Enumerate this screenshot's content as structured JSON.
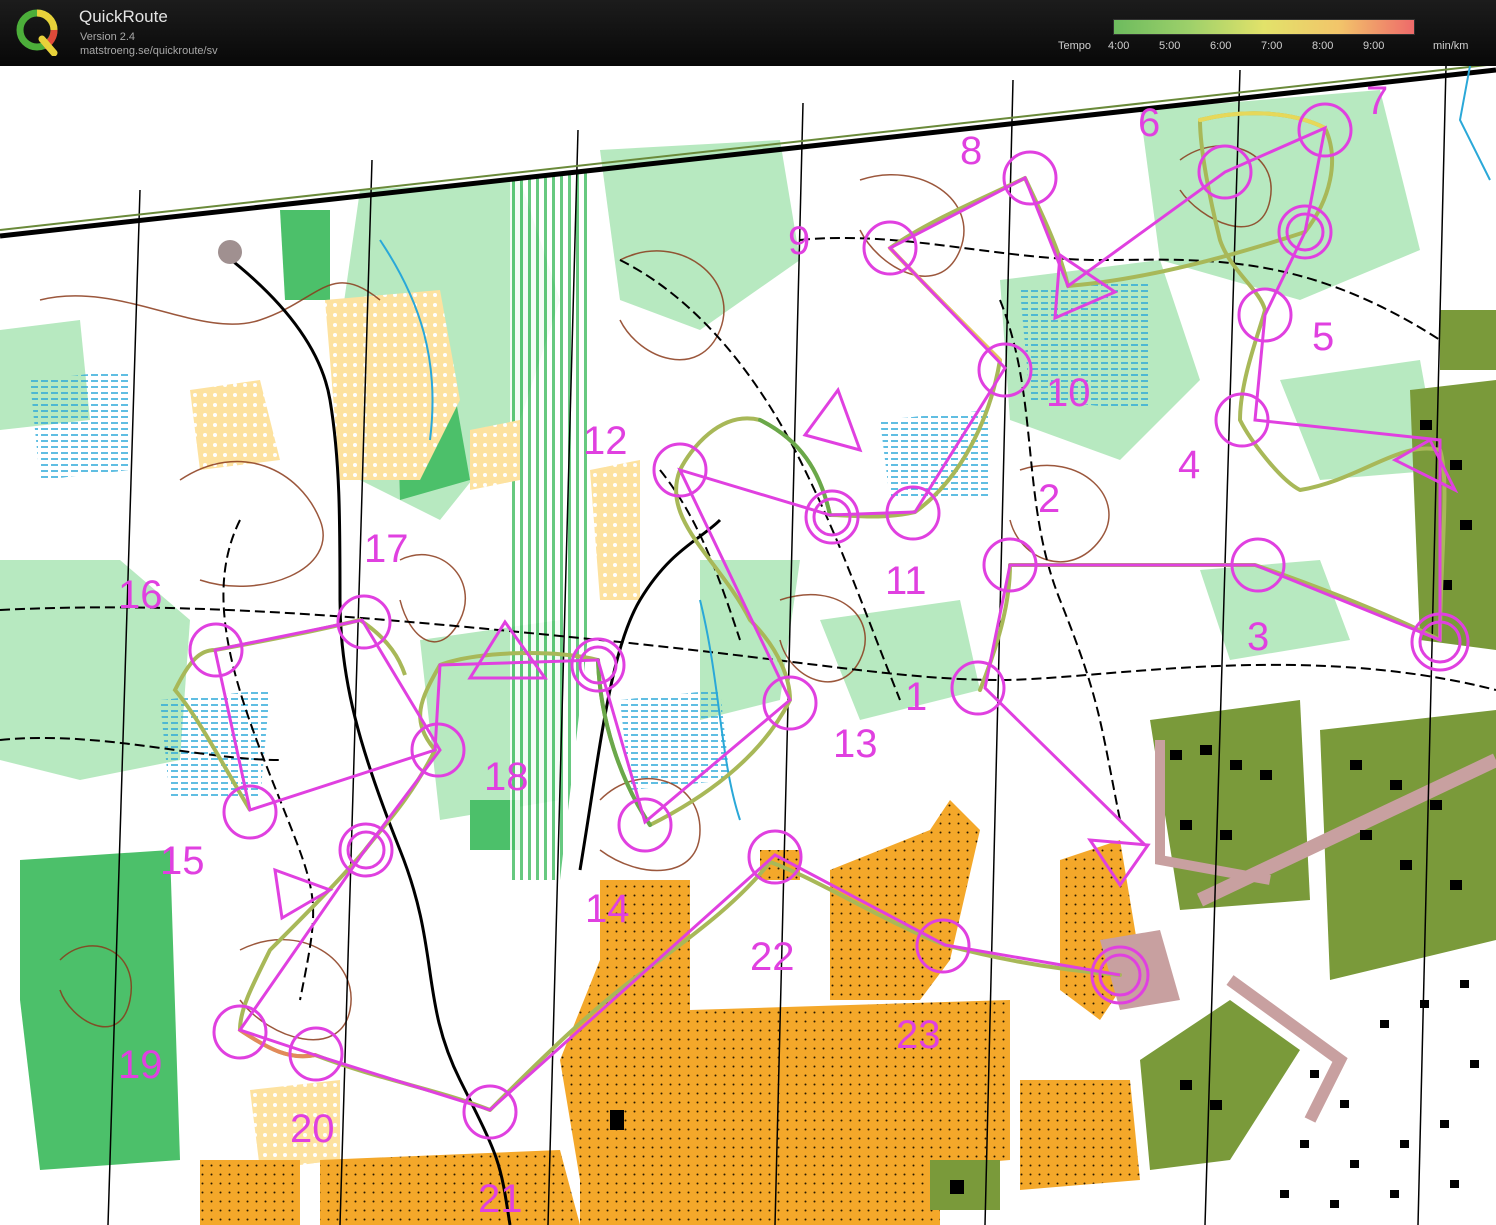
{
  "app": {
    "title": "QuickRoute",
    "version": "Version 2.4",
    "url": "matstroeng.se/quickroute/sv",
    "logo_letter": "Q"
  },
  "tempo_legend": {
    "label": "Tempo",
    "ticks": [
      "4:00",
      "5:00",
      "6:00",
      "7:00",
      "8:00",
      "9:00"
    ],
    "unit": "min/km",
    "colors": [
      "#6dbb5e",
      "#9dd06a",
      "#e2e26a",
      "#f2c56a",
      "#ee6a6a"
    ]
  },
  "map": {
    "course_color": "#e040e0",
    "route_color": "#8fa84a",
    "controls": [
      {
        "label": "1"
      },
      {
        "label": "2"
      },
      {
        "label": "3"
      },
      {
        "label": "4"
      },
      {
        "label": "5"
      },
      {
        "label": "6"
      },
      {
        "label": "7"
      },
      {
        "label": "8"
      },
      {
        "label": "9"
      },
      {
        "label": "10"
      },
      {
        "label": "11"
      },
      {
        "label": "12"
      },
      {
        "label": "13"
      },
      {
        "label": "14"
      },
      {
        "label": "15"
      },
      {
        "label": "16"
      },
      {
        "label": "17"
      },
      {
        "label": "18"
      },
      {
        "label": "19"
      },
      {
        "label": "20"
      },
      {
        "label": "21"
      },
      {
        "label": "22"
      },
      {
        "label": "23"
      }
    ]
  }
}
